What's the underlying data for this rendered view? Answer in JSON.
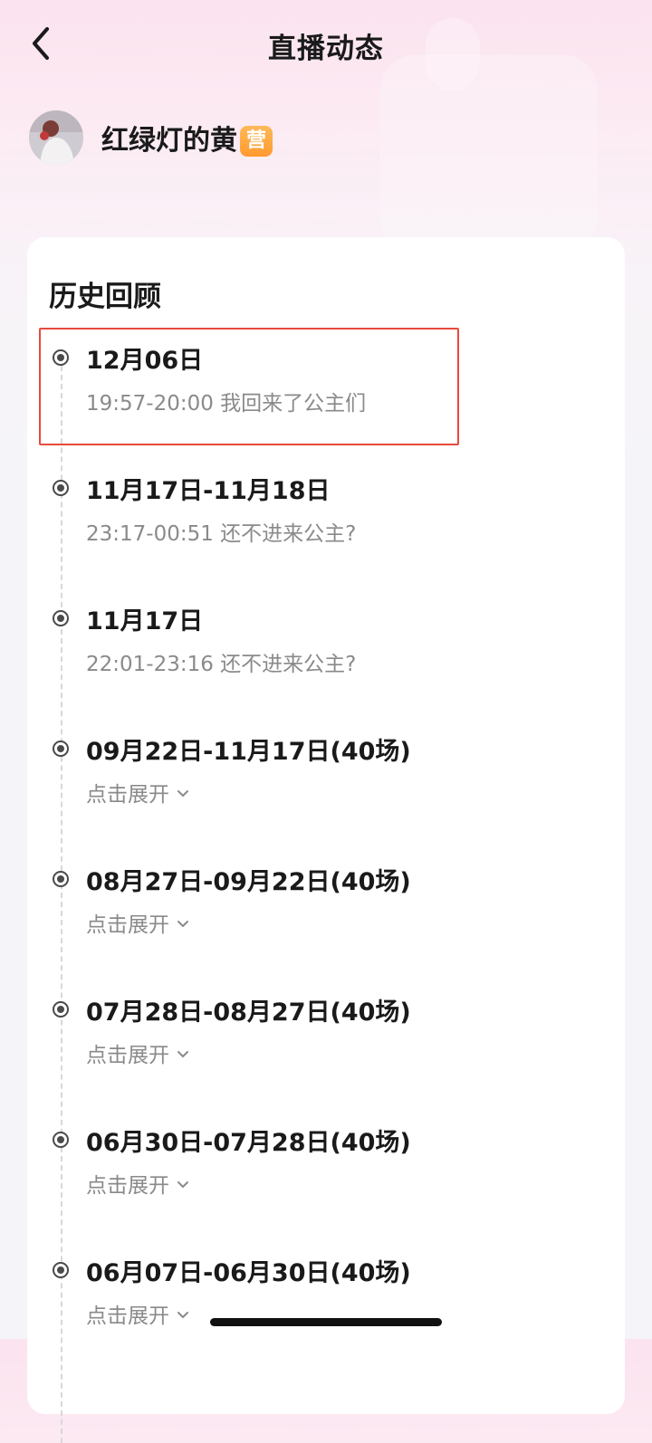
{
  "header": {
    "title": "直播动态"
  },
  "profile": {
    "name": "红绿灯的黄",
    "badge": "营"
  },
  "history": {
    "title": "历史回顾",
    "items": [
      {
        "date": "12月06日",
        "detail": "19:57-20:00 我回来了公主们",
        "highlighted": true
      },
      {
        "date": "11月17日-11月18日",
        "detail": "23:17-00:51 还不进来公主?"
      },
      {
        "date": "11月17日",
        "detail": "22:01-23:16 还不进来公主?"
      },
      {
        "date": "09月22日-11月17日(40场)",
        "expand_label": "点击展开"
      },
      {
        "date": "08月27日-09月22日(40场)",
        "expand_label": "点击展开"
      },
      {
        "date": "07月28日-08月27日(40场)",
        "expand_label": "点击展开"
      },
      {
        "date": "06月30日-07月28日(40场)",
        "expand_label": "点击展开"
      },
      {
        "date": "06月07日-06月30日(40场)",
        "expand_label": "点击展开"
      }
    ]
  },
  "colors": {
    "highlight_border": "#e84a3f",
    "badge": "#ff9a2e",
    "secondary_text": "#8a8a8a"
  },
  "icons": {
    "back": "chevron-left-icon",
    "expand": "chevron-down-icon",
    "timeline_dot": "radio-dot-icon"
  }
}
